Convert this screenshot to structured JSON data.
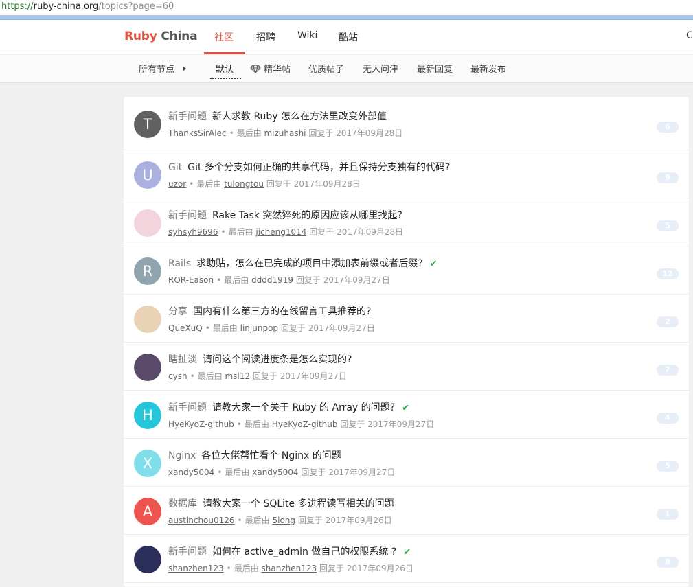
{
  "browser": {
    "url_scheme": "https://",
    "url_host": "ruby-china.org",
    "url_path": "/topics?page=60"
  },
  "nav": {
    "brand_ruby": "Ruby",
    "brand_china": "China",
    "items": [
      "社区",
      "招聘",
      "Wiki",
      "酷站"
    ],
    "active": "社区",
    "right_cutoff": "C"
  },
  "subnav": {
    "all_nodes": "所有节点",
    "filters": [
      "默认",
      "精华帖",
      "优质帖子",
      "无人问津",
      "最新回复",
      "最新发布"
    ]
  },
  "meta_labels": {
    "last_by": "最后由",
    "replied_at": "回复于"
  },
  "topics": [
    {
      "avatar_letter": "T",
      "avatar_color": "#616161",
      "node": "新手问题",
      "title": "新人求教 Ruby 怎么在方法里改变外部值",
      "solved": false,
      "author": "ThanksSirAlec",
      "last_user": "mizuhashi",
      "date": "2017年09月28日",
      "replies": "6"
    },
    {
      "avatar_letter": "U",
      "avatar_color": "#aab0e0",
      "node": "Git",
      "title": "Git 多个分支如何正确的共享代码，并且保持分支独有的代码?",
      "solved": false,
      "author": "uzor",
      "last_user": "tulongtou",
      "date": "2017年09月28日",
      "replies": "9"
    },
    {
      "avatar_letter": "",
      "avatar_color": "#f3d4dc",
      "node": "新手问题",
      "title": "Rake Task 突然猝死的原因应该从哪里找起?",
      "solved": false,
      "author": "syhsyh9696",
      "last_user": "jicheng1014",
      "date": "2017年09月28日",
      "replies": "5"
    },
    {
      "avatar_letter": "R",
      "avatar_color": "#90a4ae",
      "node": "Rails",
      "title": "求助贴，怎么在已完成的项目中添加表前缀或者后缀?",
      "solved": true,
      "author": "ROR-Eason",
      "last_user": "dddd1919",
      "date": "2017年09月27日",
      "replies": "12"
    },
    {
      "avatar_letter": "",
      "avatar_color": "#e9d2b6",
      "node": "分享",
      "title": "国内有什么第三方的在线留言工具推荐的?",
      "solved": false,
      "author": "QueXuQ",
      "last_user": "linjunpop",
      "date": "2017年09月27日",
      "replies": "2"
    },
    {
      "avatar_letter": "",
      "avatar_color": "#5a4a6a",
      "node": "瞎扯淡",
      "title": "请问这个阅读进度条是怎么实现的?",
      "solved": false,
      "author": "cysh",
      "last_user": "msl12",
      "date": "2017年09月27日",
      "replies": "7"
    },
    {
      "avatar_letter": "H",
      "avatar_color": "#26c6da",
      "node": "新手问题",
      "title": "请教大家一个关于 Ruby 的 Array 的问题?",
      "solved": true,
      "author": "HyeKyoZ-github",
      "last_user": "HyeKyoZ-github",
      "date": "2017年09月27日",
      "replies": "4"
    },
    {
      "avatar_letter": "X",
      "avatar_color": "#80deea",
      "node": "Nginx",
      "title": "各位大佬帮忙看个 Nginx 的问题",
      "solved": false,
      "author": "xandy5004",
      "last_user": "xandy5004",
      "date": "2017年09月27日",
      "replies": "5"
    },
    {
      "avatar_letter": "A",
      "avatar_color": "#ef5350",
      "node": "数据库",
      "title": "请教大家一个 SQLite 多进程读写相关的问题",
      "solved": false,
      "author": "austinchou0126",
      "last_user": "5long",
      "date": "2017年09月26日",
      "replies": "1"
    },
    {
      "avatar_letter": "",
      "avatar_color": "#2b2f5a",
      "node": "新手问题",
      "title": "如何在 active_admin 做自己的权限系统 ?",
      "solved": true,
      "author": "shanzhen123",
      "last_user": "shanzhen123",
      "date": "2017年09月26日",
      "replies": "8"
    }
  ]
}
